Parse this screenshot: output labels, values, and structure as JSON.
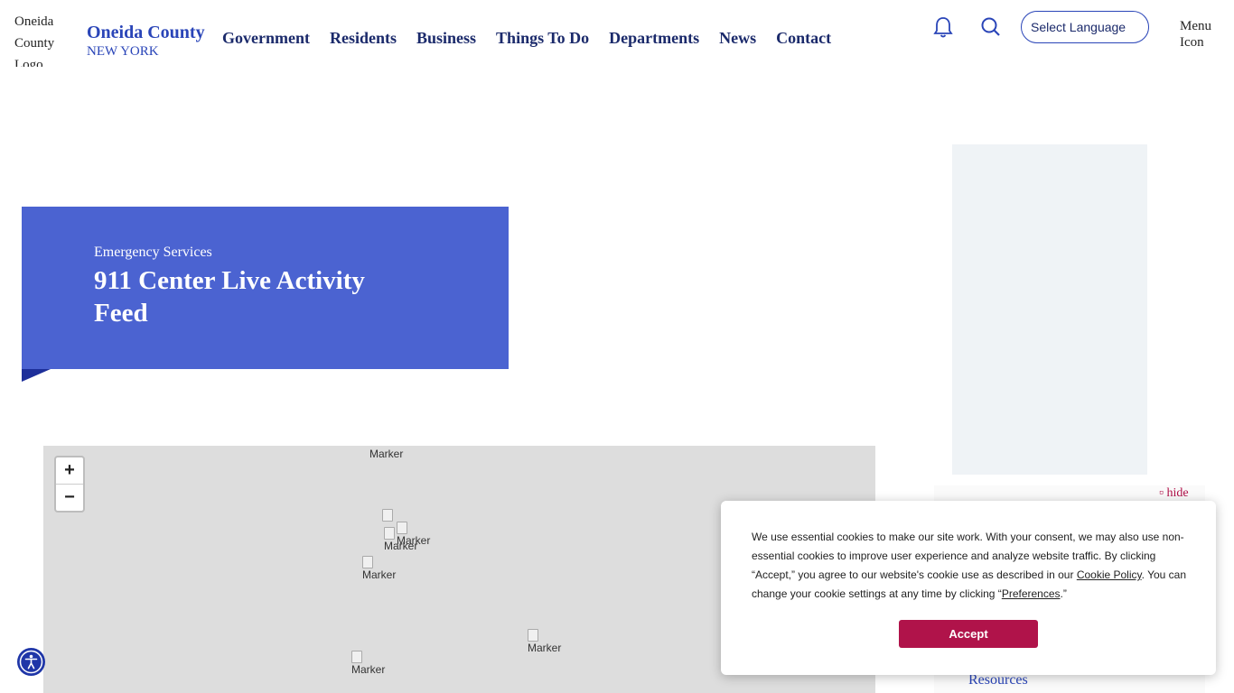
{
  "header": {
    "logo_alt": "Oneida County Logo",
    "brand_name": "Oneida County",
    "brand_sub": "NEW YORK",
    "nav": [
      "Government",
      "Residents",
      "Business",
      "Things To Do",
      "Departments",
      "News",
      "Contact"
    ],
    "language_label": "Select Language",
    "menu_alt": "Menu Icon"
  },
  "hero": {
    "kicker": "Emergency Services",
    "title": "911 Center Live Activity Feed"
  },
  "map": {
    "zoom_in": "+",
    "zoom_out": "−",
    "markers": [
      "Marker",
      "Marker",
      "Marker",
      "Marker",
      "Marker",
      "Marker",
      "Marker"
    ]
  },
  "sidebar": {
    "hide": "▫ hide",
    "resources": "Resources"
  },
  "cookie": {
    "text_1": "We use essential cookies to make our site work. With your consent, we may also use non-essential cookies to improve user experience and analyze website traffic. By clicking “Accept,” you agree to our website's cookie use as described in our ",
    "policy_link": "Cookie Policy",
    "text_2": ". You can change your cookie settings at any time by clicking “",
    "preferences_link": "Preferences",
    "text_3": ".”",
    "accept": "Accept"
  },
  "colors": {
    "hero_bg": "#4b63d1",
    "brand": "#2a45b8",
    "accept_bg": "#b0134a",
    "nav_text": "#1b2a6b"
  }
}
